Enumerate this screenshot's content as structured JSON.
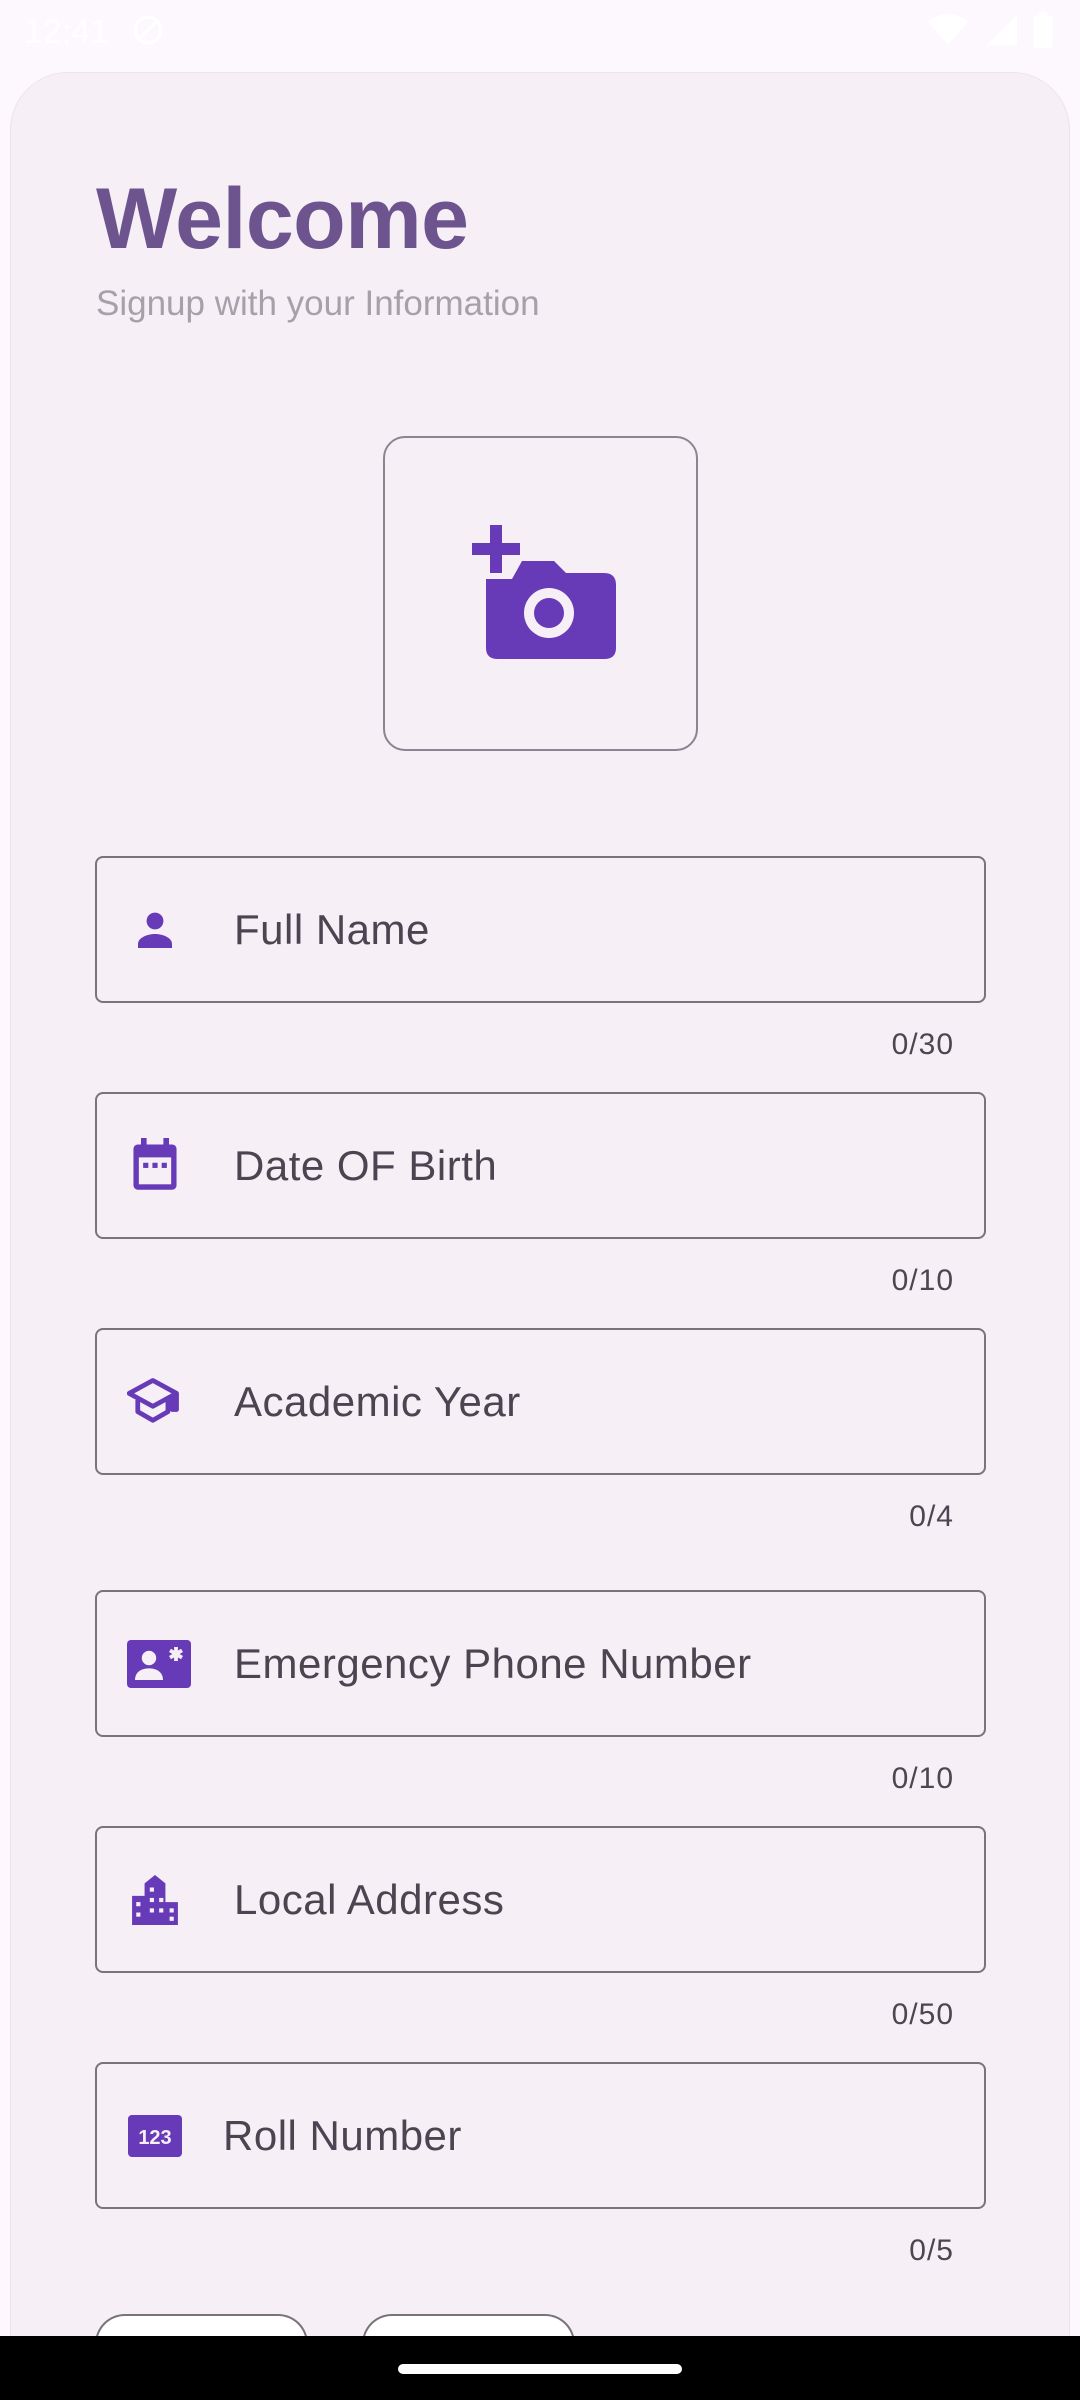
{
  "status_bar": {
    "time": "12:41"
  },
  "header": {
    "title": "Welcome",
    "subtitle": "Signup with your Information"
  },
  "photo": {
    "icon": "add-a-photo-icon"
  },
  "fields": [
    {
      "icon": "person-icon",
      "placeholder": "Full Name",
      "counter": "0/30"
    },
    {
      "icon": "calendar-icon",
      "placeholder": "Date OF Birth",
      "counter": "0/10"
    },
    {
      "icon": "school-icon",
      "placeholder": "Academic Year",
      "counter": "0/4"
    },
    {
      "icon": "contact-emergency-icon",
      "placeholder": "Emergency Phone Number",
      "counter": "0/10"
    },
    {
      "icon": "location-city-icon",
      "placeholder": "Local Address",
      "counter": "0/50"
    },
    {
      "icon": "pin-123-icon",
      "placeholder": "Roll Number",
      "counter": "0/5"
    }
  ],
  "colors": {
    "accent": "#673ab7",
    "title": "#6d548e",
    "sheet": "#f6eff6",
    "background": "#fdf7fe"
  }
}
